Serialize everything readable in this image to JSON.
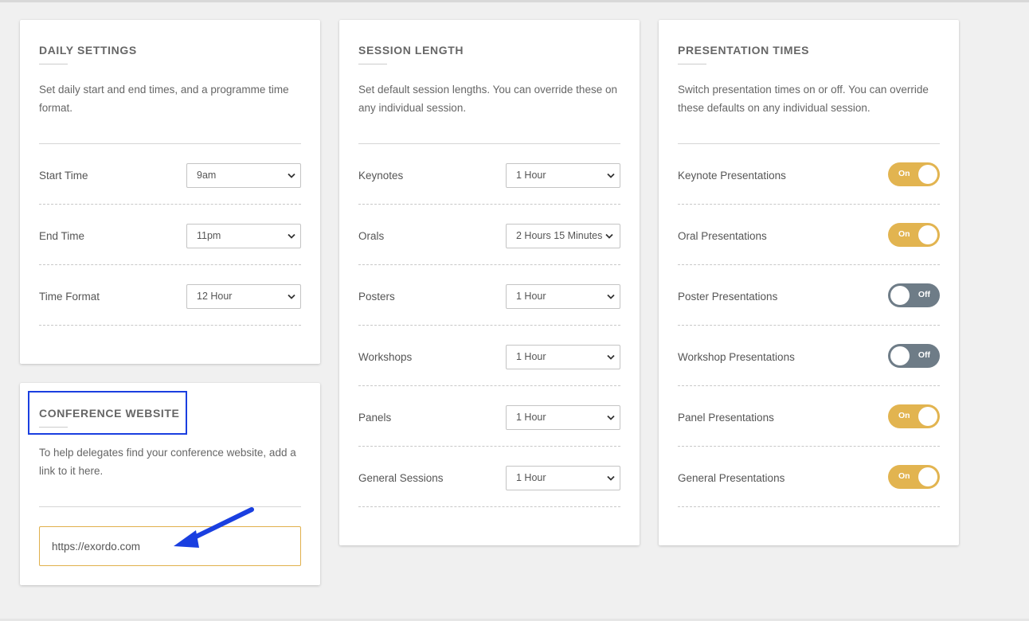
{
  "daily_settings": {
    "title": "DAILY SETTINGS",
    "description": "Set daily start and end times, and a programme time format.",
    "rows": [
      {
        "label": "Start Time",
        "value": "9am"
      },
      {
        "label": "End Time",
        "value": "11pm"
      },
      {
        "label": "Time Format",
        "value": "12 Hour"
      }
    ]
  },
  "conference_website": {
    "title": "CONFERENCE WEBSITE",
    "description": "To help delegates find your conference website, add a link to it here.",
    "url_value": "https://exordo.com"
  },
  "session_length": {
    "title": "SESSION LENGTH",
    "description": "Set default session lengths. You can override these on any individual session.",
    "rows": [
      {
        "label": "Keynotes",
        "value": "1 Hour"
      },
      {
        "label": "Orals",
        "value": "2 Hours 15 Minutes"
      },
      {
        "label": "Posters",
        "value": "1 Hour"
      },
      {
        "label": "Workshops",
        "value": "1 Hour"
      },
      {
        "label": "Panels",
        "value": "1 Hour"
      },
      {
        "label": "General Sessions",
        "value": "1 Hour"
      }
    ]
  },
  "presentation_times": {
    "title": "PRESENTATION TIMES",
    "description": "Switch presentation times on or off. You can override these defaults on any individual session.",
    "rows": [
      {
        "label": "Keynote Presentations",
        "state": "On"
      },
      {
        "label": "Oral Presentations",
        "state": "On"
      },
      {
        "label": "Poster Presentations",
        "state": "Off"
      },
      {
        "label": "Workshop Presentations",
        "state": "Off"
      },
      {
        "label": "Panel Presentations",
        "state": "On"
      },
      {
        "label": "General Presentations",
        "state": "On"
      }
    ]
  },
  "colors": {
    "toggle_on": "#e2b450",
    "toggle_off": "#6e7c87",
    "annotation": "#1a3fe0"
  }
}
